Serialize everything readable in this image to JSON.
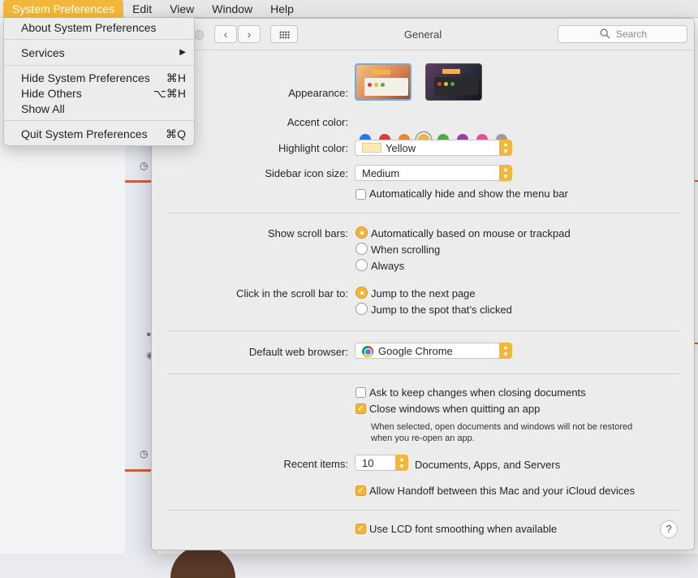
{
  "menubar": {
    "items": [
      "System Preferences",
      "Edit",
      "View",
      "Window",
      "Help"
    ]
  },
  "app_menu": {
    "about": "About System Preferences",
    "services": "Services",
    "services_arrow": "▶",
    "hide": "Hide System Preferences",
    "hide_shortcut": "⌘H",
    "hide_others": "Hide Others",
    "hide_others_shortcut": "⌥⌘H",
    "show_all": "Show All",
    "quit": "Quit System Preferences",
    "quit_shortcut": "⌘Q"
  },
  "window": {
    "title": "General",
    "search_placeholder": "Search",
    "back_icon": "chevron-left-icon",
    "forward_icon": "chevron-right-icon",
    "grid_icon": "grid-icon"
  },
  "general": {
    "appearance_label": "Appearance:",
    "accent_label": "Accent color:",
    "accent_colors": [
      "#1f7bf6",
      "#e0393e",
      "#f5862a",
      "#f2b73a",
      "#4cad45",
      "#a03bab",
      "#f24a93",
      "#9c9c9c"
    ],
    "accent_selected_index": 3,
    "highlight_label": "Highlight color:",
    "highlight_value": "Yellow",
    "sidebar_label": "Sidebar icon size:",
    "sidebar_value": "Medium",
    "auto_hide_menubar": "Automatically hide and show the menu bar",
    "scrollbars_label": "Show scroll bars:",
    "scroll_opt1": "Automatically based on mouse or trackpad",
    "scroll_opt2": "When scrolling",
    "scroll_opt3": "Always",
    "click_label": "Click in the scroll bar to:",
    "click_opt1": "Jump to the next page",
    "click_opt2": "Jump to the spot that’s clicked",
    "browser_label": "Default web browser:",
    "browser_value": "Google Chrome",
    "ask_keep": "Ask to keep changes when closing documents",
    "close_windows": "Close windows when quitting an app",
    "close_note_1": "When selected, open documents and windows will not be restored",
    "close_note_2": "when you re-open an app.",
    "recent_label": "Recent items:",
    "recent_value": "10",
    "recent_suffix": "Documents, Apps, and Servers",
    "handoff": "Allow Handoff between this Mac and your iCloud devices",
    "lcd": "Use LCD font smoothing when available",
    "help": "?"
  }
}
